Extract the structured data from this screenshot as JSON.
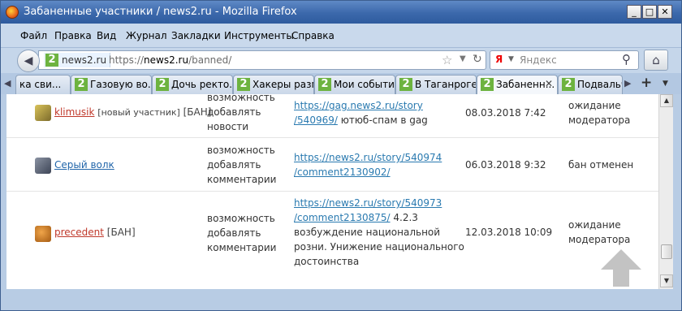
{
  "window": {
    "title": "Забаненные участники / news2.ru - Mozilla Firefox",
    "buttons": {
      "minimize": "_",
      "maximize": "□",
      "close": "✕"
    }
  },
  "menubar": {
    "items": [
      "Файл",
      "Правка",
      "Вид",
      "Журнал",
      "Закладки",
      "Инструменты",
      "Справка"
    ]
  },
  "navbar": {
    "site_identity": "news2.ru",
    "url_prefix": "https://",
    "url_domain": "news2.ru",
    "url_path": "/banned/",
    "search_placeholder": "Яндекс",
    "search_engine_letter": "Я"
  },
  "tabs": [
    {
      "label": "ка сви...",
      "active": false
    },
    {
      "label": "Газовую во...",
      "active": false
    },
    {
      "label": "Дочь ректо...",
      "active": false
    },
    {
      "label": "Хакеры разм...",
      "active": false
    },
    {
      "label": "Мои событи...",
      "active": false
    },
    {
      "label": "В Таганроге ...",
      "active": false
    },
    {
      "label": "Забаненн...",
      "active": true
    },
    {
      "label": "Подвальч...",
      "active": false
    }
  ],
  "site_logo_glyph": "2",
  "banned_list": [
    {
      "user": "klimusik",
      "user_note": "[новый участник]",
      "ban_tag": "[БАН]",
      "restriction": [
        "возможность",
        "добавлять",
        "новости"
      ],
      "link": [
        "https://gag.news2.ru/story",
        "/540969/"
      ],
      "reason": "ютюб-спам в gag",
      "date": "08.03.2018 7:42",
      "status": [
        "ожидание",
        "модератора"
      ]
    },
    {
      "user": "Серый волк",
      "user_note": "",
      "ban_tag": "",
      "restriction": [
        "возможность",
        "добавлять",
        "комментарии"
      ],
      "link": [
        "https://news2.ru/story/540974",
        "/comment2130902/"
      ],
      "reason": "",
      "date": "06.03.2018 9:32",
      "status": [
        "бан отменен"
      ]
    },
    {
      "user": "precedent",
      "user_note": "",
      "ban_tag": "[БАН]",
      "restriction": [
        "возможность",
        "добавлять",
        "комментарии"
      ],
      "link": [
        "https://news2.ru/story/540973",
        "/comment2130875/"
      ],
      "reason_lines": [
        "4.2.3",
        "возбуждение национальной",
        "розни. Унижение национального",
        "достоинства"
      ],
      "date": "12.03.2018 10:09",
      "status": [
        "ожидание",
        "модератора"
      ]
    }
  ],
  "colors": {
    "titlebar": "#3b68ab",
    "link": "#2a7ab0",
    "user_red": "#c0392b",
    "user_blue": "#2266aa"
  }
}
